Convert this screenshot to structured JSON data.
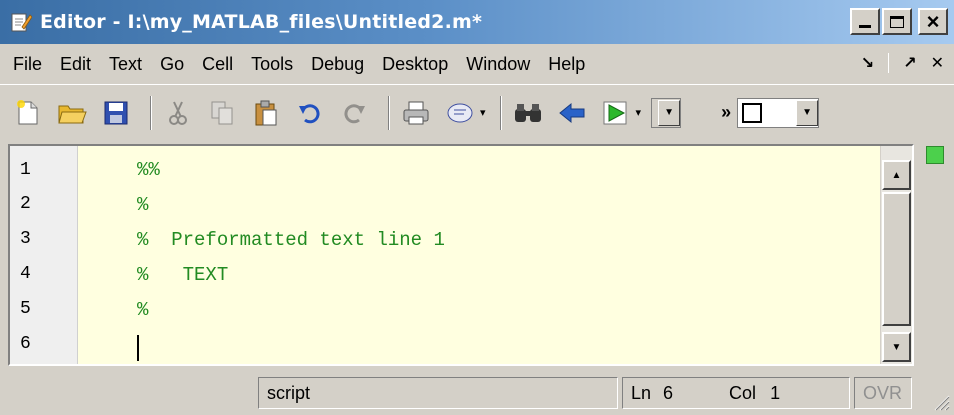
{
  "window": {
    "title": "Editor - I:\\my_MATLAB_files\\Untitled2.m*",
    "buttons": {
      "minimize": "_",
      "maximize": "□",
      "close": "×"
    }
  },
  "menubar": {
    "items": [
      "File",
      "Edit",
      "Text",
      "Go",
      "Cell",
      "Tools",
      "Debug",
      "Desktop",
      "Window",
      "Help"
    ],
    "right": {
      "dock": "↘",
      "undock": "↗",
      "close": "✕"
    }
  },
  "toolbar": {
    "icons": [
      "new-file-icon",
      "open-folder-icon",
      "save-icon",
      "cut-icon",
      "copy-icon",
      "paste-icon",
      "undo-icon",
      "redo-icon",
      "print-icon",
      "comment-icon",
      "find-icon",
      "back-arrow-icon",
      "run-icon"
    ],
    "overflow": "»"
  },
  "editor": {
    "lines": [
      {
        "num": "1",
        "text": "%%"
      },
      {
        "num": "2",
        "text": "%"
      },
      {
        "num": "3",
        "text": "%  Preformatted text line 1"
      },
      {
        "num": "4",
        "text": "%   TEXT"
      },
      {
        "num": "5",
        "text": "%"
      },
      {
        "num": "6",
        "text": ""
      }
    ],
    "colors": {
      "background": "#ffffe0",
      "comment": "#228b22"
    }
  },
  "statusbar": {
    "mode": "script",
    "ln_label": "Ln",
    "ln_value": "6",
    "col_label": "Col",
    "col_value": "1",
    "ovr": "OVR"
  }
}
